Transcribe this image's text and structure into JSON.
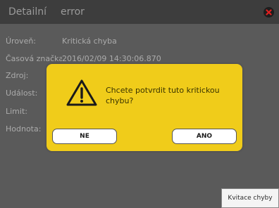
{
  "header": {
    "title": "Detailní",
    "status": "error",
    "close_icon": "close-x-circle-icon"
  },
  "fields": [
    {
      "label": "Úroveň:",
      "value": "Kritická chyba"
    },
    {
      "label": "Časová značka",
      "value": "2016/02/09 14:30:06.870"
    },
    {
      "label": "Zdroj:",
      "value": ""
    },
    {
      "label": "Událost:",
      "value": ""
    },
    {
      "label": "Limit:",
      "value": ""
    },
    {
      "label": "Hodnota:",
      "value": ""
    }
  ],
  "dialog": {
    "icon": "warning-triangle-icon",
    "message": "Chcete potvrdit tuto kritickou chybu?",
    "no_label": "NE",
    "yes_label": "ANO",
    "background_color": "#f0cc1a"
  },
  "footer": {
    "acknowledge_label": "Kvitace chyby"
  }
}
